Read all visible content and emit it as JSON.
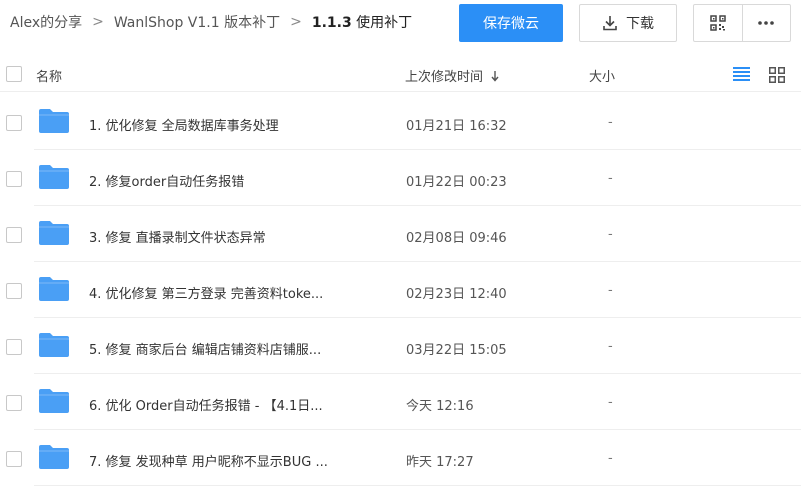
{
  "breadcrumb": {
    "items": [
      "Alex的分享",
      "WanlShop V1.1 版本补丁"
    ],
    "current_bold": "1.1.3",
    "current_rest": " 使用补丁"
  },
  "toolbar": {
    "save_label": "保存微云",
    "download_label": "下载",
    "qr_icon": "qr-code-icon",
    "more_icon": "more-icon"
  },
  "table": {
    "col_name": "名称",
    "col_modified": "上次修改时间",
    "col_size": "大小",
    "sort_icon": "arrow-down-icon",
    "rows": [
      {
        "name": "1. 优化修复 全局数据库事务处理",
        "date": "01月21日 16:32",
        "size": "-"
      },
      {
        "name": "2. 修复order自动任务报错",
        "date": "01月22日 00:23",
        "size": "-"
      },
      {
        "name": "3. 修复 直播录制文件状态异常",
        "date": "02月08日 09:46",
        "size": "-"
      },
      {
        "name": "4. 优化修复 第三方登录 完善资料toke...",
        "date": "02月23日 12:40",
        "size": "-"
      },
      {
        "name": "5. 修复 商家后台 编辑店铺资料店铺服...",
        "date": "03月22日 15:05",
        "size": "-"
      },
      {
        "name": "6. 优化 Order自动任务报错 - 【4.1日...",
        "date": "今天 12:16",
        "size": "-"
      },
      {
        "name": "7. 修复 发现种草 用户昵称不显示BUG ...",
        "date": "昨天 17:27",
        "size": "-"
      }
    ]
  },
  "colors": {
    "accent": "#2b8ff6",
    "folder": "#4a9ff5",
    "list_view_active": "#2b8ff6"
  }
}
